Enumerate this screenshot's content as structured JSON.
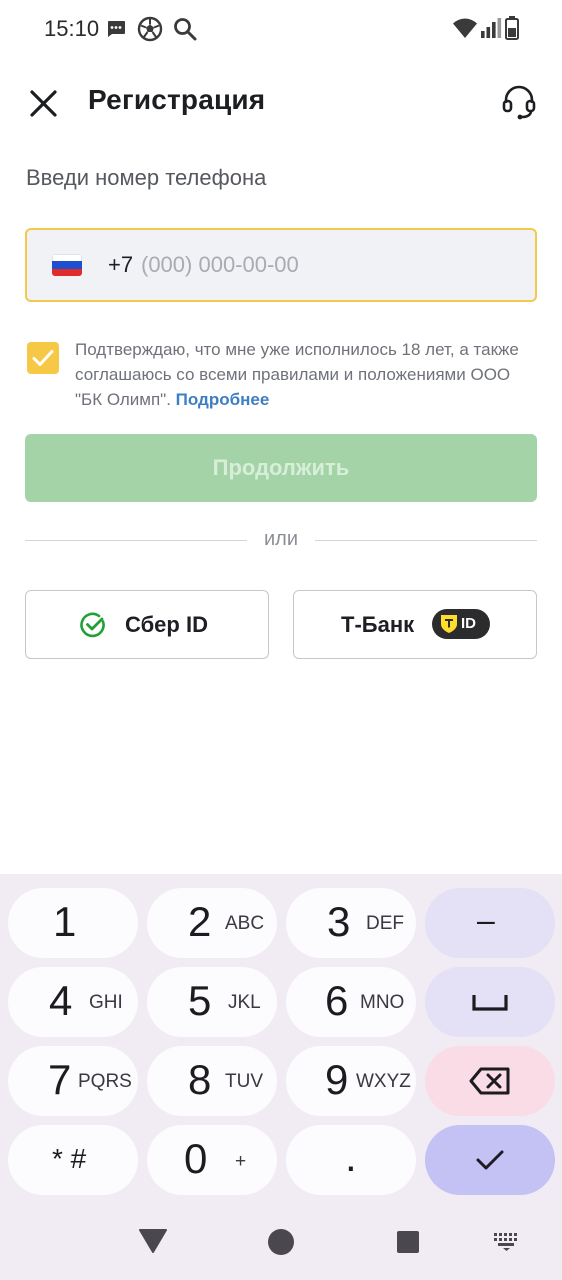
{
  "status_bar": {
    "time": "15:10",
    "icons": [
      "message-icon",
      "soccer-ball-icon",
      "search-icon",
      "wifi-icon",
      "signal-icon",
      "battery-icon"
    ]
  },
  "header": {
    "title": "Регистрация",
    "close_icon": "close-icon",
    "support_icon": "headset-icon"
  },
  "form": {
    "phone_label": "Введи номер телефона",
    "country_flag": "russia-flag-icon",
    "phone_prefix": "+7",
    "phone_value": "",
    "phone_placeholder": "(000) 000-00-00",
    "consent_checked": true,
    "consent_text": "Подтверждаю, что мне уже исполнилось 18 лет, а также соглашаюсь со всеми правилами и положениями ООО \"БК Олимп\".",
    "consent_link": "Подробнее",
    "continue_label": "Продолжить",
    "or_label": "или"
  },
  "auth_providers": {
    "sber_label": "Сбер ID",
    "tbank_label": "Т-Банк",
    "tbank_badge": "ID"
  },
  "keyboard": {
    "keys": {
      "k1": {
        "main": "1",
        "sub": ""
      },
      "k2": {
        "main": "2",
        "sub": "ABC"
      },
      "k3": {
        "main": "3",
        "sub": "DEF"
      },
      "k4": {
        "main": "4",
        "sub": "GHI"
      },
      "k5": {
        "main": "5",
        "sub": "JKL"
      },
      "k6": {
        "main": "6",
        "sub": "MNO"
      },
      "k7": {
        "main": "7",
        "sub": "PQRS"
      },
      "k8": {
        "main": "8",
        "sub": "TUV"
      },
      "k9": {
        "main": "9",
        "sub": "WXYZ"
      },
      "kstar": {
        "main": "* #",
        "sub": ""
      },
      "k0": {
        "main": "0",
        "sub": "+"
      },
      "kdot": {
        "main": ".",
        "sub": ""
      },
      "kminus": {
        "main": "–",
        "sub": ""
      }
    }
  },
  "colors": {
    "accent_yellow": "#f7c845",
    "continue_disabled": "#a3d3a7",
    "link_blue": "#3e7ec2",
    "sber_green": "#21a038"
  }
}
